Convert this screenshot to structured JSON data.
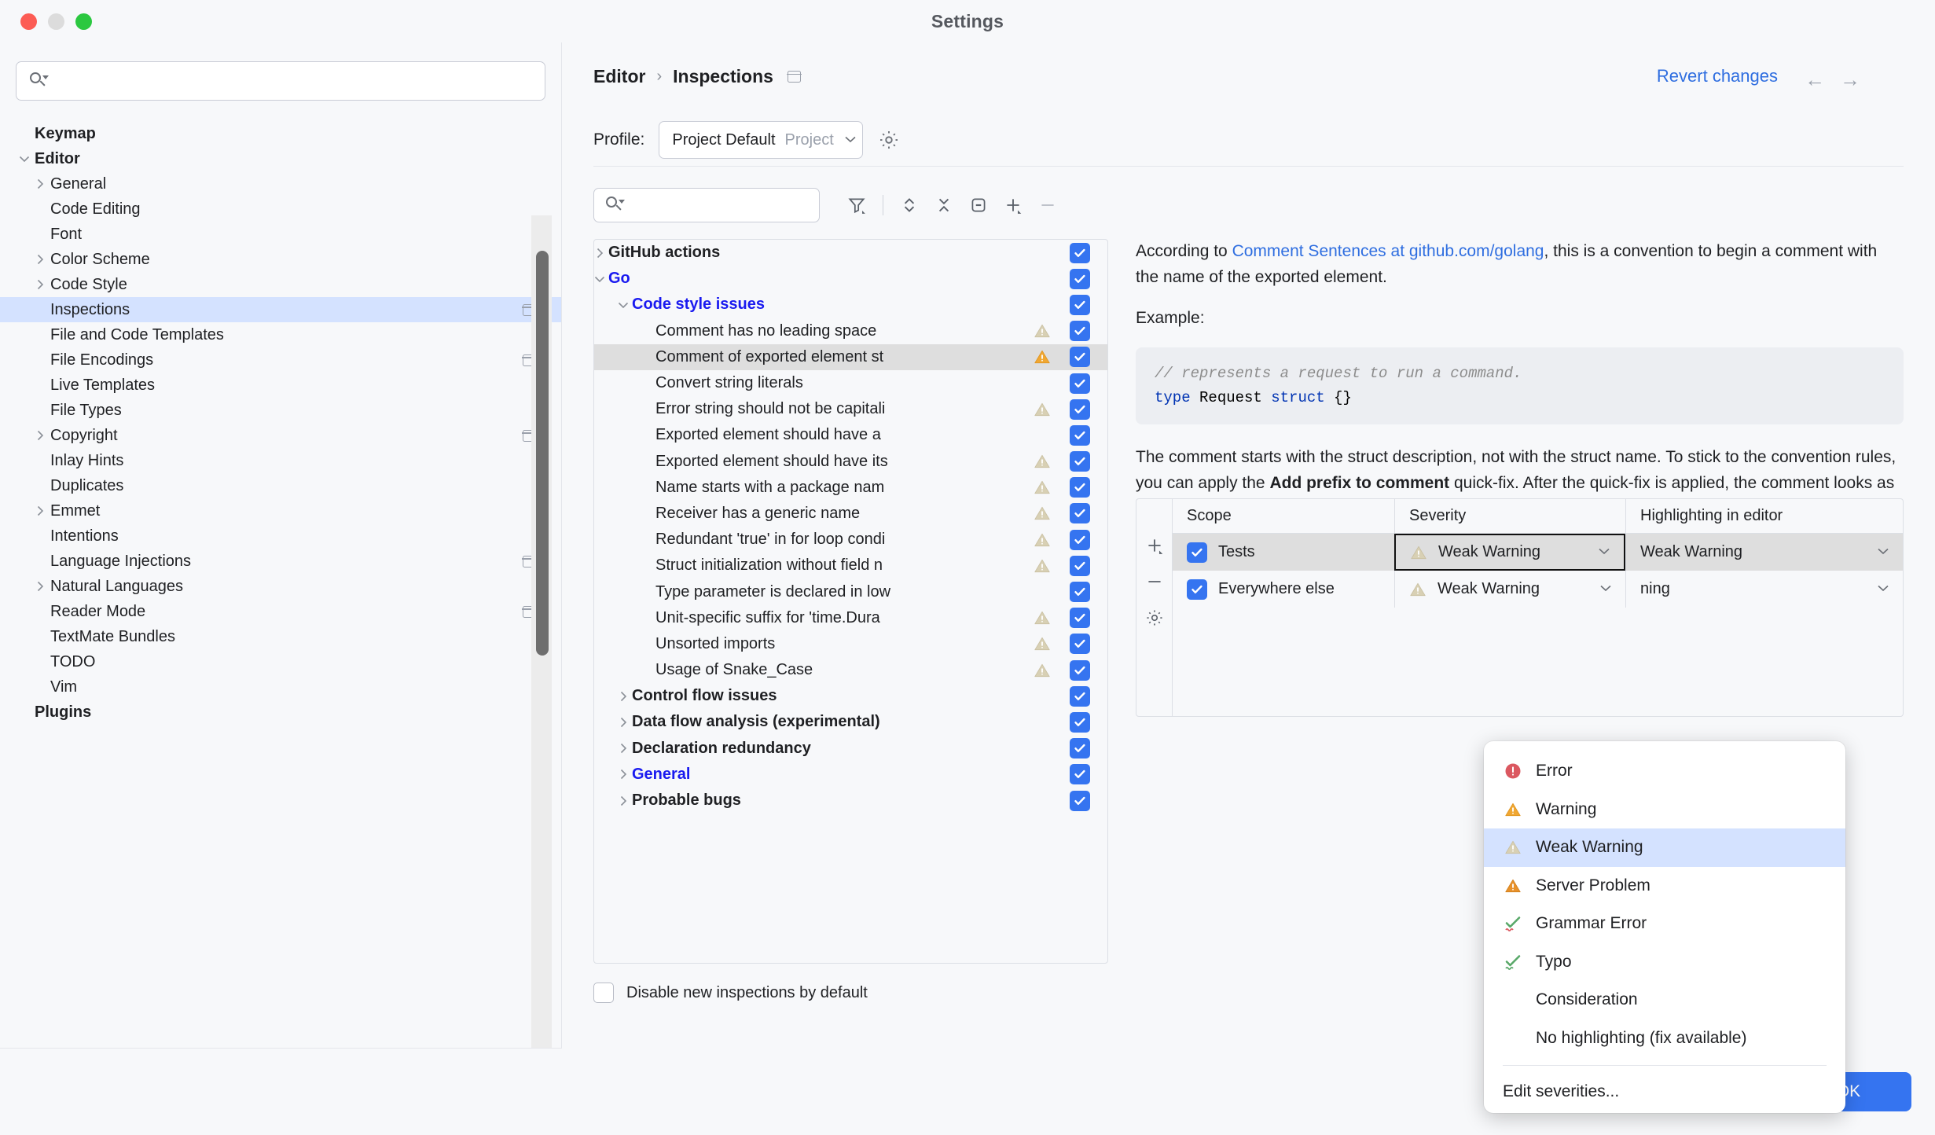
{
  "window": {
    "title": "Settings"
  },
  "sidebar": {
    "search_placeholder": "",
    "search_value": "",
    "items": [
      {
        "label": "Keymap",
        "indent": 44,
        "bold": true,
        "chev": "none",
        "selected": false,
        "badge": false
      },
      {
        "label": "Editor",
        "indent": 44,
        "bold": true,
        "chev": "down",
        "selected": false,
        "badge": false
      },
      {
        "label": "General",
        "indent": 64,
        "bold": false,
        "chev": "right",
        "selected": false,
        "badge": false
      },
      {
        "label": "Code Editing",
        "indent": 64,
        "bold": false,
        "chev": "none",
        "selected": false,
        "badge": false
      },
      {
        "label": "Font",
        "indent": 64,
        "bold": false,
        "chev": "none",
        "selected": false,
        "badge": false
      },
      {
        "label": "Color Scheme",
        "indent": 64,
        "bold": false,
        "chev": "right",
        "selected": false,
        "badge": false
      },
      {
        "label": "Code Style",
        "indent": 64,
        "bold": false,
        "chev": "right",
        "selected": false,
        "badge": false
      },
      {
        "label": "Inspections",
        "indent": 64,
        "bold": false,
        "chev": "none",
        "selected": true,
        "badge": true
      },
      {
        "label": "File and Code Templates",
        "indent": 64,
        "bold": false,
        "chev": "none",
        "selected": false,
        "badge": false
      },
      {
        "label": "File Encodings",
        "indent": 64,
        "bold": false,
        "chev": "none",
        "selected": false,
        "badge": true
      },
      {
        "label": "Live Templates",
        "indent": 64,
        "bold": false,
        "chev": "none",
        "selected": false,
        "badge": false
      },
      {
        "label": "File Types",
        "indent": 64,
        "bold": false,
        "chev": "none",
        "selected": false,
        "badge": false
      },
      {
        "label": "Copyright",
        "indent": 64,
        "bold": false,
        "chev": "right",
        "selected": false,
        "badge": true
      },
      {
        "label": "Inlay Hints",
        "indent": 64,
        "bold": false,
        "chev": "none",
        "selected": false,
        "badge": false
      },
      {
        "label": "Duplicates",
        "indent": 64,
        "bold": false,
        "chev": "none",
        "selected": false,
        "badge": false
      },
      {
        "label": "Emmet",
        "indent": 64,
        "bold": false,
        "chev": "right",
        "selected": false,
        "badge": false
      },
      {
        "label": "Intentions",
        "indent": 64,
        "bold": false,
        "chev": "none",
        "selected": false,
        "badge": false
      },
      {
        "label": "Language Injections",
        "indent": 64,
        "bold": false,
        "chev": "none",
        "selected": false,
        "badge": true
      },
      {
        "label": "Natural Languages",
        "indent": 64,
        "bold": false,
        "chev": "right",
        "selected": false,
        "badge": false
      },
      {
        "label": "Reader Mode",
        "indent": 64,
        "bold": false,
        "chev": "none",
        "selected": false,
        "badge": true
      },
      {
        "label": "TextMate Bundles",
        "indent": 64,
        "bold": false,
        "chev": "none",
        "selected": false,
        "badge": false
      },
      {
        "label": "TODO",
        "indent": 64,
        "bold": false,
        "chev": "none",
        "selected": false,
        "badge": false
      },
      {
        "label": "Vim",
        "indent": 64,
        "bold": false,
        "chev": "none",
        "selected": false,
        "badge": false
      },
      {
        "label": "Plugins",
        "indent": 44,
        "bold": true,
        "chev": "none",
        "selected": false,
        "badge": false
      }
    ],
    "help_glyph": "?"
  },
  "header": {
    "breadcrumb": [
      "Editor",
      "Inspections"
    ],
    "separator": "›",
    "revert_label": "Revert changes",
    "back_glyph": "←",
    "forward_glyph": "→"
  },
  "profile": {
    "label": "Profile:",
    "name": "Project Default",
    "scope": "Project",
    "chevron": "⌄"
  },
  "toolbar": {
    "filter_placeholder": "",
    "filter_value": "",
    "icons": [
      "filter-icon",
      "expand-collapse-icon",
      "collapse-all-icon",
      "group-by-icon",
      "add-icon",
      "remove-icon"
    ]
  },
  "inspections": {
    "rows": [
      {
        "label": "GitHub actions",
        "indent": 18,
        "chev": "right",
        "cat": true,
        "blue": false,
        "warn": "none",
        "checked": true,
        "hl": false
      },
      {
        "label": "Go",
        "indent": 18,
        "chev": "down",
        "cat": true,
        "blue": true,
        "warn": "none",
        "checked": true,
        "hl": false
      },
      {
        "label": "Code style issues",
        "indent": 48,
        "chev": "down",
        "cat": true,
        "blue": true,
        "warn": "none",
        "checked": true,
        "hl": false
      },
      {
        "label": "Comment has no leading space",
        "indent": 78,
        "chev": "none",
        "cat": false,
        "blue": false,
        "warn": "weak",
        "checked": true,
        "hl": false
      },
      {
        "label": "Comment of exported element st",
        "indent": 78,
        "chev": "none",
        "cat": false,
        "blue": false,
        "warn": "strong",
        "checked": true,
        "hl": true
      },
      {
        "label": "Convert string literals",
        "indent": 78,
        "chev": "none",
        "cat": false,
        "blue": false,
        "warn": "none",
        "checked": true,
        "hl": false
      },
      {
        "label": "Error string should not be capitali",
        "indent": 78,
        "chev": "none",
        "cat": false,
        "blue": false,
        "warn": "weak",
        "checked": true,
        "hl": false
      },
      {
        "label": "Exported element should have a",
        "indent": 78,
        "chev": "none",
        "cat": false,
        "blue": false,
        "warn": "none",
        "checked": true,
        "hl": false
      },
      {
        "label": "Exported element should have its",
        "indent": 78,
        "chev": "none",
        "cat": false,
        "blue": false,
        "warn": "weak",
        "checked": true,
        "hl": false
      },
      {
        "label": "Name starts with a package nam",
        "indent": 78,
        "chev": "none",
        "cat": false,
        "blue": false,
        "warn": "weak",
        "checked": true,
        "hl": false
      },
      {
        "label": "Receiver has a generic name",
        "indent": 78,
        "chev": "none",
        "cat": false,
        "blue": false,
        "warn": "weak",
        "checked": true,
        "hl": false
      },
      {
        "label": "Redundant 'true' in for loop condi",
        "indent": 78,
        "chev": "none",
        "cat": false,
        "blue": false,
        "warn": "weak",
        "checked": true,
        "hl": false
      },
      {
        "label": "Struct initialization without field n",
        "indent": 78,
        "chev": "none",
        "cat": false,
        "blue": false,
        "warn": "weak",
        "checked": true,
        "hl": false
      },
      {
        "label": "Type parameter is declared in low",
        "indent": 78,
        "chev": "none",
        "cat": false,
        "blue": false,
        "warn": "none",
        "checked": true,
        "hl": false
      },
      {
        "label": "Unit-specific suffix for 'time.Dura",
        "indent": 78,
        "chev": "none",
        "cat": false,
        "blue": false,
        "warn": "weak",
        "checked": true,
        "hl": false
      },
      {
        "label": "Unsorted imports",
        "indent": 78,
        "chev": "none",
        "cat": false,
        "blue": false,
        "warn": "weak",
        "checked": true,
        "hl": false
      },
      {
        "label": "Usage of Snake_Case",
        "indent": 78,
        "chev": "none",
        "cat": false,
        "blue": false,
        "warn": "weak",
        "checked": true,
        "hl": false
      },
      {
        "label": "Control flow issues",
        "indent": 48,
        "chev": "right",
        "cat": true,
        "blue": false,
        "warn": "none",
        "checked": true,
        "hl": false
      },
      {
        "label": "Data flow analysis (experimental)",
        "indent": 48,
        "chev": "right",
        "cat": true,
        "blue": false,
        "warn": "none",
        "checked": true,
        "hl": false
      },
      {
        "label": "Declaration redundancy",
        "indent": 48,
        "chev": "right",
        "cat": true,
        "blue": false,
        "warn": "none",
        "checked": true,
        "hl": false
      },
      {
        "label": "General",
        "indent": 48,
        "chev": "right",
        "cat": true,
        "blue": true,
        "warn": "none",
        "checked": true,
        "hl": false
      },
      {
        "label": "Probable bugs",
        "indent": 48,
        "chev": "right",
        "cat": true,
        "blue": false,
        "warn": "none",
        "checked": true,
        "hl": false
      }
    ],
    "disable_new_label": "Disable new inspections by default",
    "disable_new_checked": false
  },
  "description": {
    "p1_pre": "According to ",
    "p1_link": "Comment Sentences at github.com/golang",
    "p1_post": ", this is a convention to begin a comment with the name of the exported element.",
    "example_label": "Example:",
    "code1_comment": "// represents a request to run a command.",
    "code1_kw1": "type",
    "code1_name": " Request ",
    "code1_kw2": "struct",
    "code1_tail": " {}",
    "p2_pre": "The comment starts with the struct description, not with the struct name. To stick to the convention rules, you can apply the ",
    "p2_bold": "Add prefix to comment",
    "p2_post": " quick-fix. After the quick-fix is applied, the comment looks as follows:"
  },
  "scope_table": {
    "headers": [
      "Scope",
      "Severity",
      "Highlighting in editor"
    ],
    "gutter_icons": [
      "add-icon",
      "remove-icon",
      "gear-icon"
    ],
    "rows": [
      {
        "scope": "Tests",
        "checked": true,
        "severity": "Weak Warning",
        "severity_icon": "weak-warning-icon",
        "highlighting": "Weak Warning",
        "selected": true,
        "focused": true
      },
      {
        "scope": "Everywhere else",
        "checked": true,
        "severity": "Weak Warning",
        "severity_icon": "weak-warning-icon",
        "highlighting": "ning",
        "selected": false,
        "focused": false
      }
    ]
  },
  "severity_dropdown": {
    "items": [
      {
        "label": "Error",
        "icon": "error-icon",
        "selected": false
      },
      {
        "label": "Warning",
        "icon": "warning-icon",
        "selected": false
      },
      {
        "label": "Weak Warning",
        "icon": "weak-warning-icon",
        "selected": true
      },
      {
        "label": "Server Problem",
        "icon": "server-problem-icon",
        "selected": false
      },
      {
        "label": "Grammar Error",
        "icon": "grammar-error-icon",
        "selected": false
      },
      {
        "label": "Typo",
        "icon": "typo-icon",
        "selected": false
      },
      {
        "label": "Consideration",
        "icon": "none",
        "selected": false
      },
      {
        "label": "No highlighting (fix available)",
        "icon": "none",
        "selected": false
      }
    ],
    "footer_label": "Edit severities..."
  },
  "footer": {
    "cancel_label": "",
    "apply_label": "",
    "ok_label": "OK"
  },
  "colors": {
    "accent": "#3574f0",
    "link": "#2f6ee0",
    "selection": "#d4e2ff",
    "error": "#db5860",
    "warning": "#f0a732",
    "weak_warning": "#d4ccb0",
    "server_problem": "#e8912a",
    "grammar": "#59a869"
  }
}
